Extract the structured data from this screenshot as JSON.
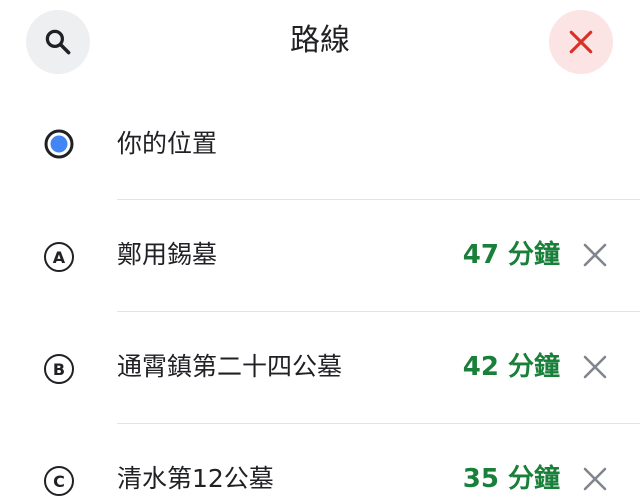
{
  "header": {
    "title": "路線",
    "search_icon": "search-icon",
    "close_icon": "close-icon",
    "close_color": "#d93025"
  },
  "origin": {
    "label": "你的位置",
    "icon": "current-location-icon",
    "dot_color": "#4285f4"
  },
  "destinations": [
    {
      "marker": "A",
      "label": "鄭用錫墓",
      "duration": "47 分鐘"
    },
    {
      "marker": "B",
      "label": "通霄鎮第二十四公墓",
      "duration": "42 分鐘"
    },
    {
      "marker": "C",
      "label": "清水第12公墓",
      "duration": "35 分鐘"
    }
  ],
  "colors": {
    "duration": "#188038",
    "remove_icon": "#80868b"
  }
}
